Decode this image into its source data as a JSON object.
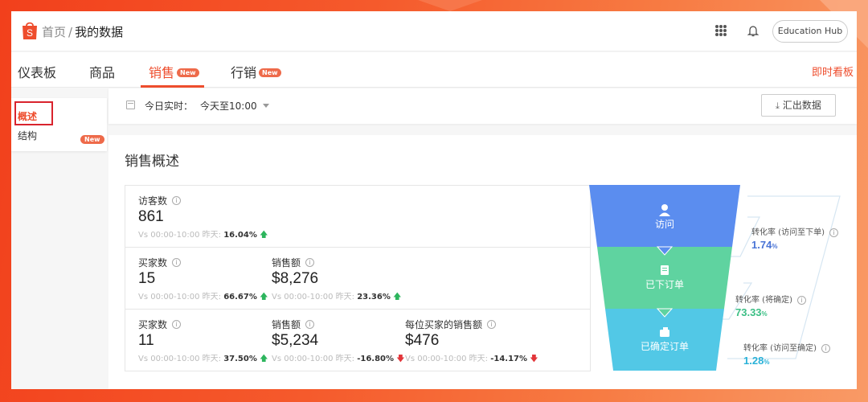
{
  "header": {
    "breadcrumb_home": "首页",
    "breadcrumb_sep": "/",
    "breadcrumb_current": "我的数据",
    "education_hub": "Education Hub"
  },
  "tabs": [
    {
      "label": "仪表板",
      "badge": null,
      "active": false
    },
    {
      "label": "商品",
      "badge": null,
      "active": false
    },
    {
      "label": "销售",
      "badge": "New",
      "active": true
    },
    {
      "label": "行销",
      "badge": "New",
      "active": false
    }
  ],
  "live_board": "即时看板",
  "sidebar": {
    "items": [
      {
        "label": "概述",
        "active": true,
        "badge": null
      },
      {
        "label": "结构",
        "active": false,
        "badge": "New"
      }
    ]
  },
  "filter": {
    "label": "今日实时：",
    "value": "今天至10:00",
    "export_label": "汇出数据"
  },
  "section_title": "销售概述",
  "metric_rows": [
    [
      {
        "label": "访客数",
        "value": "861",
        "cmp_prefix": "Vs 00:00-10:00 昨天:",
        "pct": "16.04%",
        "trend": "up"
      }
    ],
    [
      {
        "label": "买家数",
        "value": "15",
        "cmp_prefix": "Vs 00:00-10:00 昨天:",
        "pct": "66.67%",
        "trend": "up"
      },
      {
        "label": "销售额",
        "value": "$8,276",
        "cmp_prefix": "Vs 00:00-10:00 昨天:",
        "pct": "23.36%",
        "trend": "up"
      }
    ],
    [
      {
        "label": "买家数",
        "value": "11",
        "cmp_prefix": "Vs 00:00-10:00 昨天:",
        "pct": "37.50%",
        "trend": "up"
      },
      {
        "label": "销售额",
        "value": "$5,234",
        "cmp_prefix": "Vs 00:00-10:00 昨天:",
        "pct": "-16.80%",
        "trend": "down"
      },
      {
        "label": "每位买家的销售额",
        "value": "$476",
        "cmp_prefix": "Vs 00:00-10:00 昨天:",
        "pct": "-14.17%",
        "trend": "down"
      }
    ]
  ],
  "funnel": {
    "stages": [
      {
        "label": "访问",
        "icon": "user-icon",
        "color": "#5b8def"
      },
      {
        "label": "已下订单",
        "icon": "document-icon",
        "color": "#5fd3a0"
      },
      {
        "label": "已确定订单",
        "icon": "wallet-icon",
        "color": "#52c8e6"
      }
    ],
    "conversions": [
      {
        "label": "转化率 (访问至下单)",
        "value": "1.74",
        "unit": "%",
        "color": "#4a74d6"
      },
      {
        "label": "转化率 (将确定)",
        "value": "73.33",
        "unit": "%",
        "color": "#3cbf85"
      },
      {
        "label": "转化率 (访问至确定)",
        "value": "1.28",
        "unit": "%",
        "color": "#2ab2d8"
      }
    ]
  },
  "colors": {
    "accent": "#ee4d2d",
    "up": "#2db55d",
    "down": "#e2353a"
  }
}
